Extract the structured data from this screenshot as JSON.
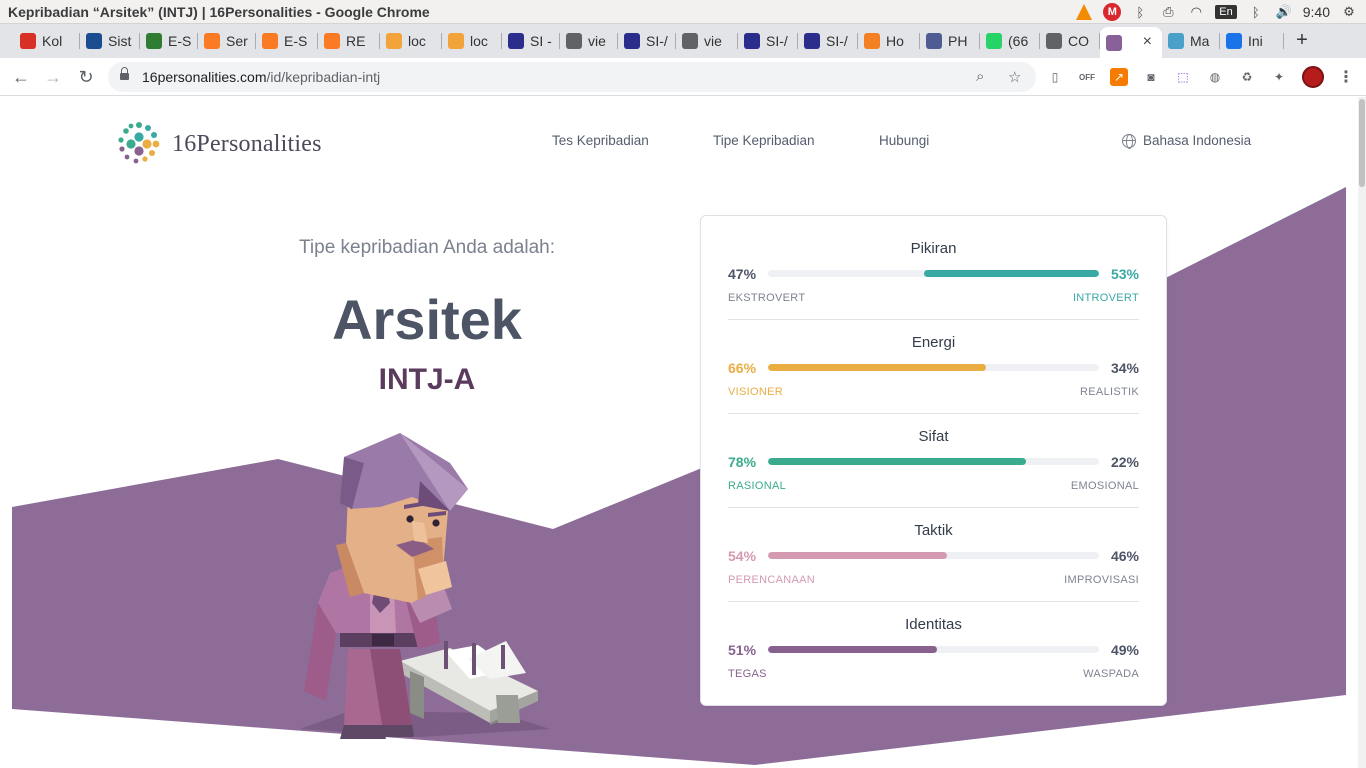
{
  "os": {
    "window_title": "Kepribadian “Arsitek” (INTJ) | 16Personalities - Google Chrome",
    "keyboard_layout": "En",
    "clock": "9:40"
  },
  "tabs": [
    {
      "label": "Kol",
      "icon": "gmail-icon",
      "color": "#d93025"
    },
    {
      "label": "Sist",
      "icon": "shield-crest-icon",
      "color": "#1a4d8f"
    },
    {
      "label": "E-S",
      "icon": "shield-crest-icon",
      "color": "#2e7d32"
    },
    {
      "label": "Ser",
      "icon": "xampp-icon",
      "color": "#fb7a24"
    },
    {
      "label": "E-S",
      "icon": "xampp-icon",
      "color": "#fb7a24"
    },
    {
      "label": "RE",
      "icon": "xampp-icon",
      "color": "#fb7a24"
    },
    {
      "label": "loc",
      "icon": "phpmyadmin-icon",
      "color": "#f2a33a"
    },
    {
      "label": "loc",
      "icon": "phpmyadmin-icon",
      "color": "#f2a33a"
    },
    {
      "label": "SI -",
      "icon": "shield-crest-icon",
      "color": "#2b2d8c"
    },
    {
      "label": "vie",
      "icon": "globe-icon",
      "color": "#5f6368"
    },
    {
      "label": "SI-/",
      "icon": "shield-crest-icon",
      "color": "#2b2d8c"
    },
    {
      "label": "vie",
      "icon": "globe-icon",
      "color": "#5f6368"
    },
    {
      "label": "SI-/",
      "icon": "shield-crest-icon",
      "color": "#2b2d8c"
    },
    {
      "label": "SI-/",
      "icon": "shield-crest-icon",
      "color": "#2b2d8c"
    },
    {
      "label": "Ho",
      "icon": "stackoverflow-icon",
      "color": "#f48024"
    },
    {
      "label": "PH",
      "icon": "php-icon",
      "color": "#4f5b93"
    },
    {
      "label": "(66",
      "icon": "whatsapp-icon",
      "color": "#25d366"
    },
    {
      "label": "CO",
      "icon": "globe-icon",
      "color": "#5f6368"
    },
    {
      "label": "",
      "icon": "16personalities-icon",
      "color": "#88619a"
    },
    {
      "label": "Ma",
      "icon": "map-icon",
      "color": "#4aa0c8"
    },
    {
      "label": "Ini",
      "icon": "circle-arrow-icon",
      "color": "#1a73e8"
    }
  ],
  "address_bar": {
    "host": "16personalities.com",
    "path": "/id/kepribadian-intj"
  },
  "site": {
    "logo_text": "16Personalities",
    "nav": {
      "test": "Tes Kepribadian",
      "types": "Tipe Kepribadian",
      "contact": "Hubungi"
    },
    "language": "Bahasa Indonesia"
  },
  "result": {
    "intro": "Tipe kepribadian Anda adalah:",
    "type_name": "Arsitek",
    "type_code": "INTJ-A"
  },
  "traits": [
    {
      "title": "Pikiran",
      "left_pct": "47%",
      "right_pct": "53%",
      "left_label": "EKSTROVERT",
      "right_label": "INTROVERT",
      "dominant": "right",
      "fill_fraction": 0.53,
      "color": "#39a9a4"
    },
    {
      "title": "Energi",
      "left_pct": "66%",
      "right_pct": "34%",
      "left_label": "VISIONER",
      "right_label": "REALISTIK",
      "dominant": "left",
      "fill_fraction": 0.66,
      "color": "#e9ad42"
    },
    {
      "title": "Sifat",
      "left_pct": "78%",
      "right_pct": "22%",
      "left_label": "RASIONAL",
      "right_label": "EMOSIONAL",
      "dominant": "left",
      "fill_fraction": 0.78,
      "color": "#3aab8c"
    },
    {
      "title": "Taktik",
      "left_pct": "54%",
      "right_pct": "46%",
      "left_label": "PERENCANAAN",
      "right_label": "IMPROVISASI",
      "dominant": "left",
      "fill_fraction": 0.54,
      "color": "#d49ab2"
    },
    {
      "title": "Identitas",
      "left_pct": "51%",
      "right_pct": "49%",
      "left_label": "TEGAS",
      "right_label": "WASPADA",
      "dominant": "left",
      "fill_fraction": 0.51,
      "color": "#88618f"
    }
  ],
  "colors": {
    "background_band": "#8d6d98",
    "heading": "#4c5465",
    "type_code": "#5a3b5e",
    "neutral_text": "#7d8390"
  }
}
